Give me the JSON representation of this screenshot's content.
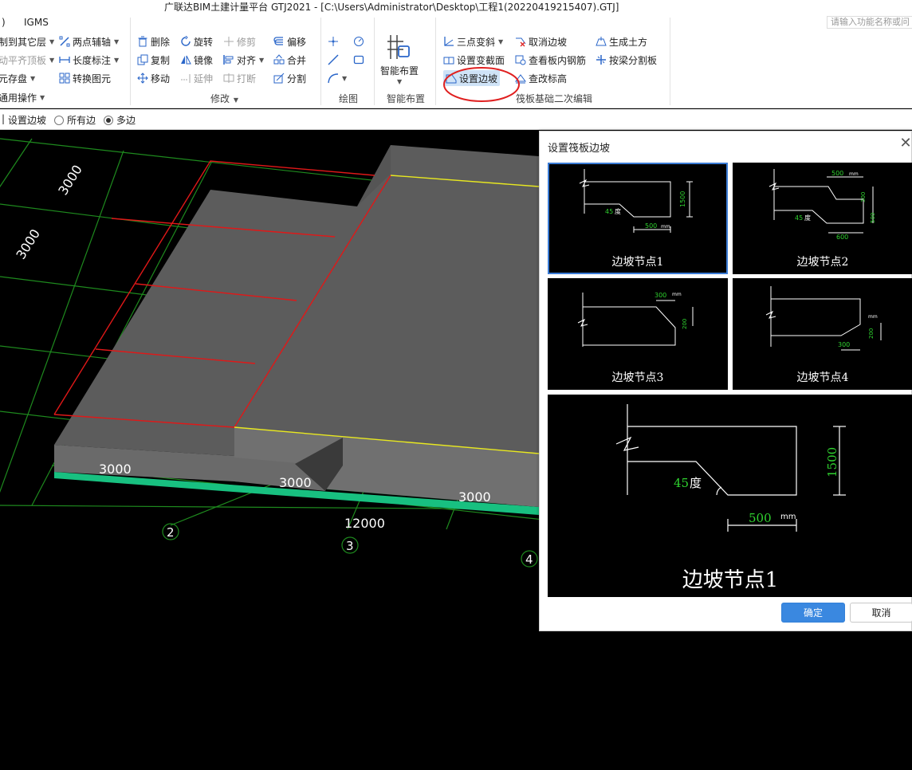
{
  "window": {
    "title": "广联达BIM土建计量平台 GTJ2021 - [C:\\Users\\Administrator\\Desktop\\工程1(20220419215407).GTJ]"
  },
  "menubar": {
    "left_fragment": ")",
    "igms": "IGMS",
    "search_placeholder": "请输入功能名称或问"
  },
  "ribbon": {
    "col0": {
      "copy_to_layer": "制到其它层",
      "align_top": "动平齐顶板",
      "save_elem": "元存盘",
      "common_ops": "通用操作"
    },
    "col1": {
      "two_point_axis": "两点辅轴",
      "length_dim": "长度标注",
      "convert_elem": "转换图元"
    },
    "modify": {
      "delete": "删除",
      "rotate": "旋转",
      "trim": "修剪",
      "offset": "偏移",
      "copy": "复制",
      "mirror": "镜像",
      "align": "对齐",
      "merge": "合并",
      "move": "移动",
      "extend": "延伸",
      "break": "打断",
      "split": "分割",
      "group_label": "修改"
    },
    "draw": {
      "group_label": "绘图"
    },
    "smart": {
      "button": "智能布置",
      "group_label": "智能布置"
    },
    "raft": {
      "three_point_slope": "三点变斜",
      "cancel_edge": "取消边坡",
      "gen_earthwork": "生成土方",
      "set_section": "设置变截面",
      "view_rebar": "查看板内钢筋",
      "split_by_beam": "按梁分割板",
      "set_edge_slope": "设置边坡",
      "check_elev": "查改标高",
      "group_label": "筏板基础二次编辑"
    }
  },
  "subbar": {
    "set_edge_slope": "设置边坡",
    "all_edges": "所有边",
    "multi_edges": "多边",
    "selected": "多边"
  },
  "viewport": {
    "dims": [
      "3000",
      "3000",
      "3000",
      "3000",
      "3000",
      "12000"
    ],
    "axes": [
      "2",
      "3",
      "4"
    ]
  },
  "dialog": {
    "title": "设置筏板边坡",
    "close": "✕",
    "nodes": [
      {
        "caption": "边坡节点1",
        "angle": "45",
        "angle_unit": "度",
        "width": "500",
        "unit": "mm",
        "height": "1500"
      },
      {
        "caption": "边坡节点2",
        "top_width": "500",
        "unit": "mm",
        "angle": "45",
        "angle_unit": "度",
        "bottom_width": "600",
        "h1": "300",
        "h2": "500"
      },
      {
        "caption": "边坡节点3",
        "width": "300",
        "unit": "mm",
        "height": "200"
      },
      {
        "caption": "边坡节点4",
        "width": "300",
        "unit": "mm",
        "height": "200"
      }
    ],
    "preview": {
      "caption": "边坡节点1",
      "angle": "45",
      "angle_unit": "度",
      "width": "500",
      "unit": "mm",
      "height": "1500"
    },
    "ok": "确定",
    "cancel": "取消"
  },
  "colors": {
    "grid": "#1e8a1e",
    "red_edge": "#e01818",
    "yellow_edge": "#e8e820",
    "slab": "#5c5c5c",
    "slab_side": "#6e6e6e",
    "accent": "#3a88e0"
  }
}
